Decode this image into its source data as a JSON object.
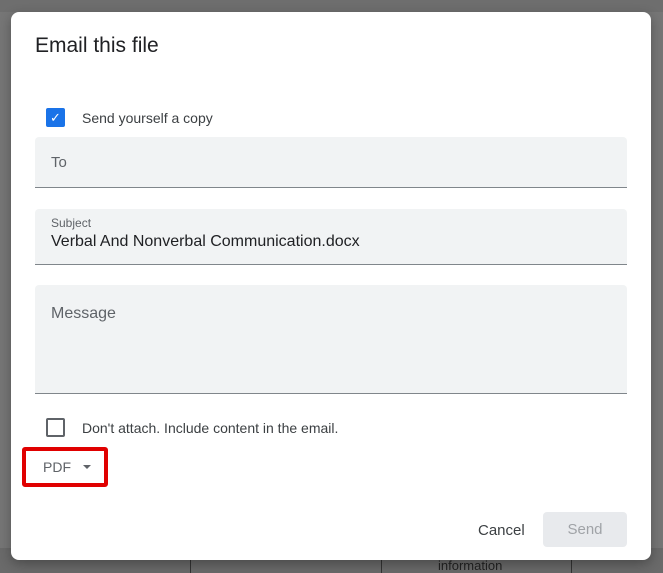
{
  "background": {
    "cell_text": "information"
  },
  "dialog": {
    "title": "Email this file",
    "send_copy": {
      "label": "Send yourself a copy",
      "checked": true
    },
    "to": {
      "placeholder": "To",
      "value": ""
    },
    "subject": {
      "label": "Subject",
      "value": "Verbal And Nonverbal Communication.docx"
    },
    "message": {
      "placeholder": "Message",
      "value": ""
    },
    "dont_attach": {
      "label": "Don't attach. Include content in the email.",
      "checked": false
    },
    "format": {
      "selected": "PDF"
    },
    "cancel_label": "Cancel",
    "send_label": "Send",
    "highlight_color": "#e00000",
    "accent_color": "#1a73e8"
  }
}
